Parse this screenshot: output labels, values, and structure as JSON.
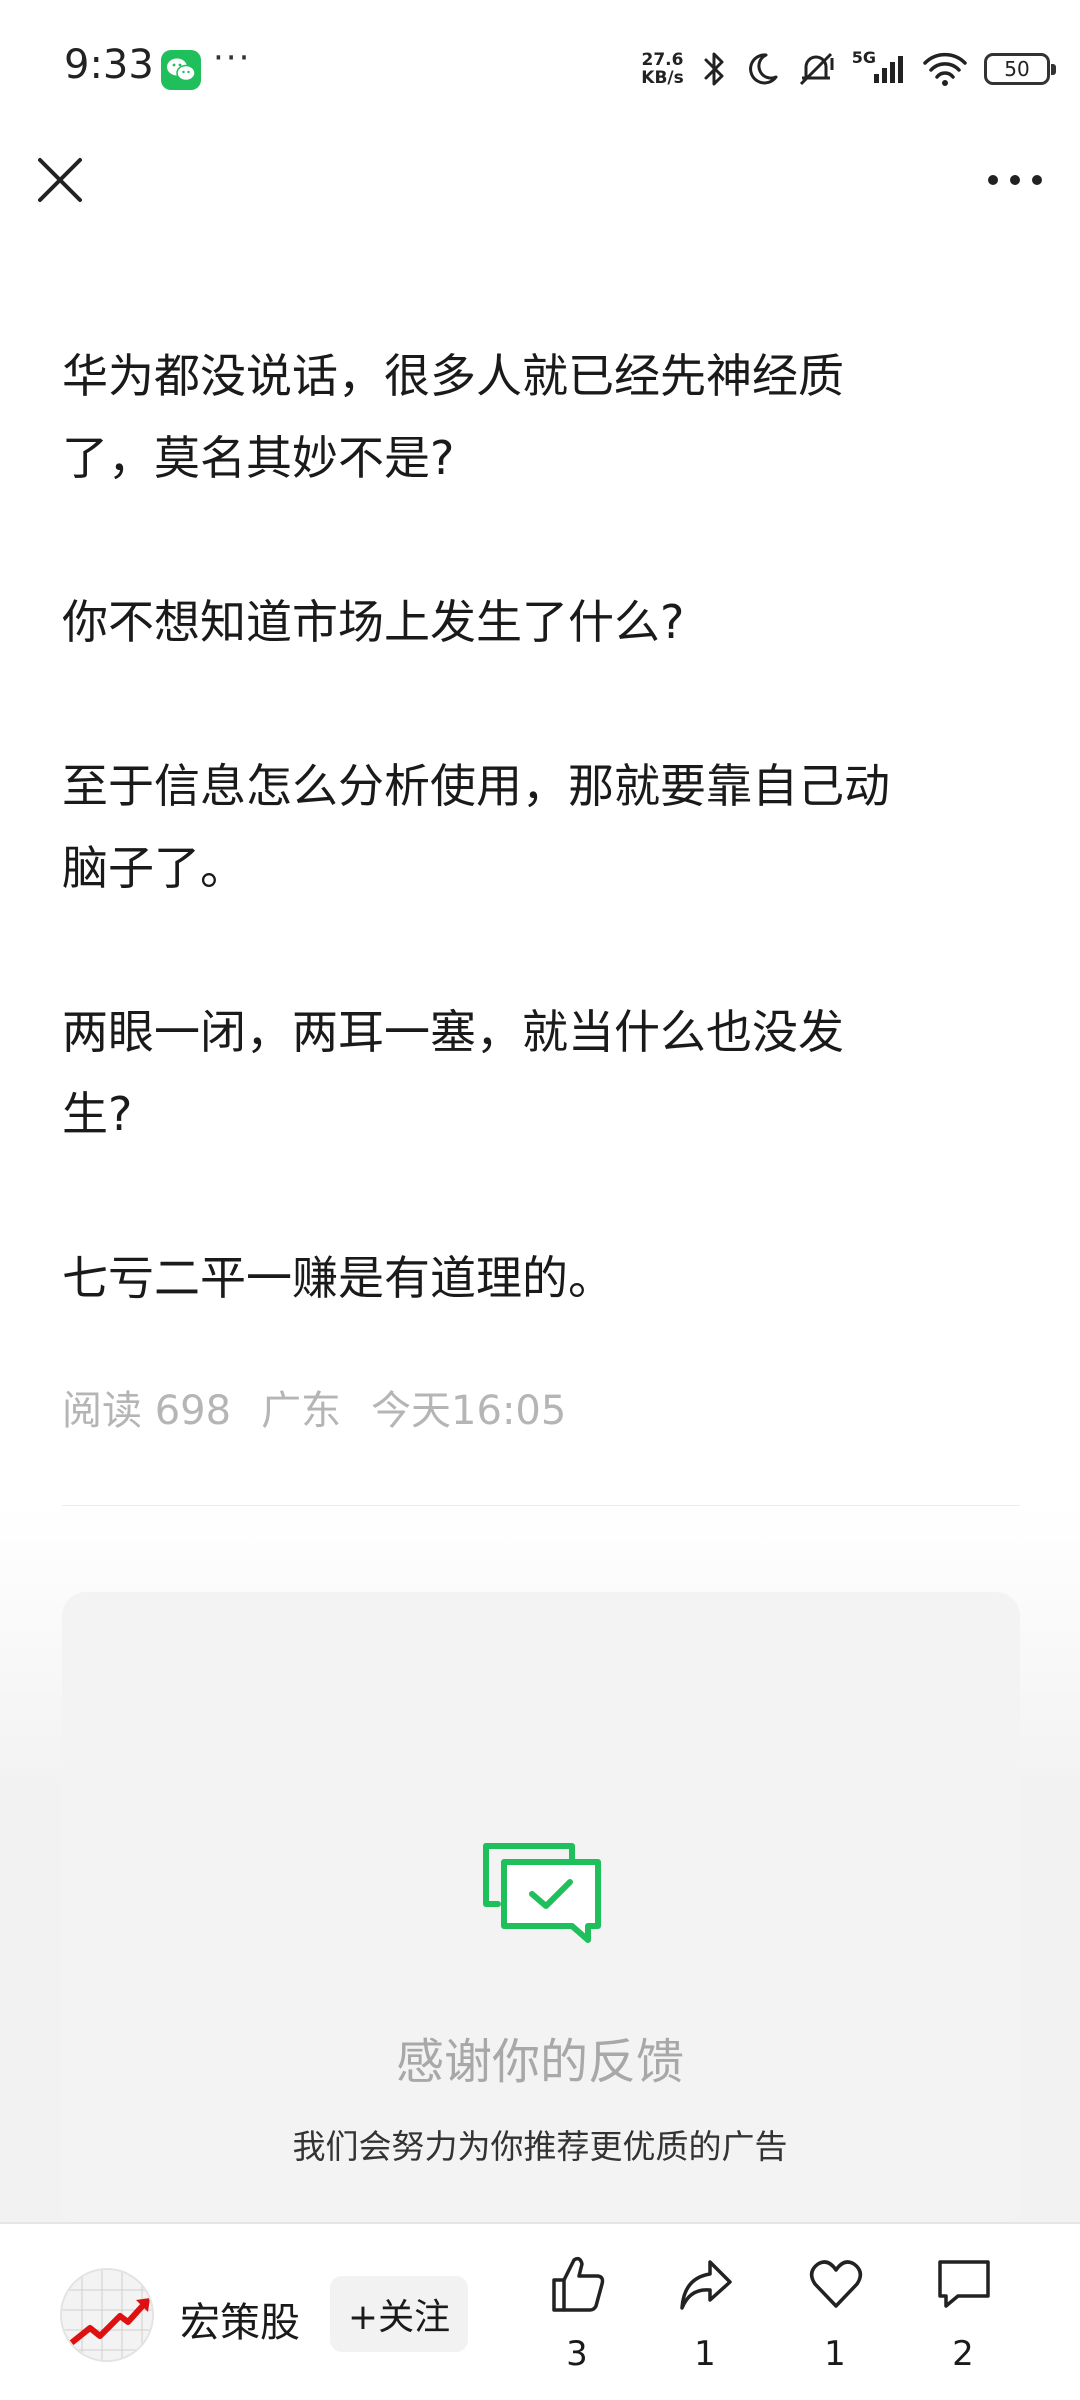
{
  "status_bar": {
    "time": "9:33",
    "more": "···",
    "speed_value": "27.6",
    "speed_unit": "KB/s",
    "network": "5G",
    "battery": "50"
  },
  "article": {
    "paragraphs": [
      "华为都没说话，很多人就已经先神经质\n了，莫名其妙不是?",
      "你不想知道市场上发生了什么?",
      "至于信息怎么分析使用，那就要靠自己动\n脑子了。",
      "两眼一闭，两耳一塞，就当什么也没发\n生?",
      "七亏二平一赚是有道理的。"
    ],
    "meta": {
      "reads": "阅读 698",
      "location": "广东",
      "time": "今天16:05"
    }
  },
  "feedback": {
    "title": "感谢你的反馈",
    "subtitle": "我们会努力为你推荐更优质的广告"
  },
  "bottom_bar": {
    "author": "宏策股",
    "follow": "+关注",
    "like_count": "3",
    "share_count": "1",
    "favorite_count": "1",
    "comment_count": "2"
  },
  "icons": {
    "close": "close-icon",
    "more": "more-icon",
    "like": "thumbs-up-icon",
    "share": "share-icon",
    "favorite": "heart-icon",
    "comment": "comment-icon",
    "feedback": "feedback-check-icon"
  },
  "colors": {
    "accent_green": "#1fbf5c",
    "meta_gray": "#b5b5b5"
  }
}
